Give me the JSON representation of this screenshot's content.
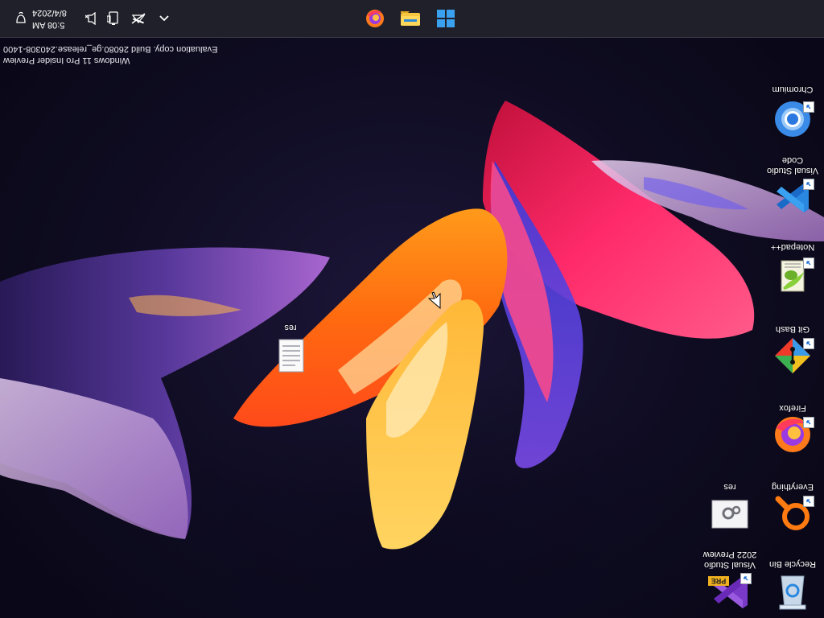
{
  "taskbar": {
    "pinned": [
      {
        "name": "Firefox",
        "icon": "firefox-icon"
      },
      {
        "name": "File Explorer",
        "icon": "folder-icon"
      },
      {
        "name": "Start",
        "icon": "windows-logo-icon"
      }
    ],
    "tray": {
      "icons": [
        "chevron-up-icon",
        "network-icon",
        "battery-icon",
        "volume-icon",
        "notification-icon"
      ],
      "time": "5:08 AM",
      "date": "8/4/2024"
    }
  },
  "watermark": {
    "line1": "Windows 11 Pro Insider Preview",
    "line2": "Evaluation copy. Build 26080.ge_release.240308-1400"
  },
  "desktop_icons": {
    "chromium": "Chromium",
    "vscode": "Visual Studio Code",
    "notepadpp": "Notepad++",
    "gitbash": "Git Bash",
    "firefox": "Firefox",
    "everything": "Everything",
    "recycle_bin": "Recycle Bin",
    "res_settings": "res",
    "vs2022": "Visual Studio 2022 Preview",
    "res_text": "res",
    "vs_badge": "PRE"
  },
  "colors": {
    "taskbar": "#20202a",
    "accent_blue": "#0078d4"
  }
}
